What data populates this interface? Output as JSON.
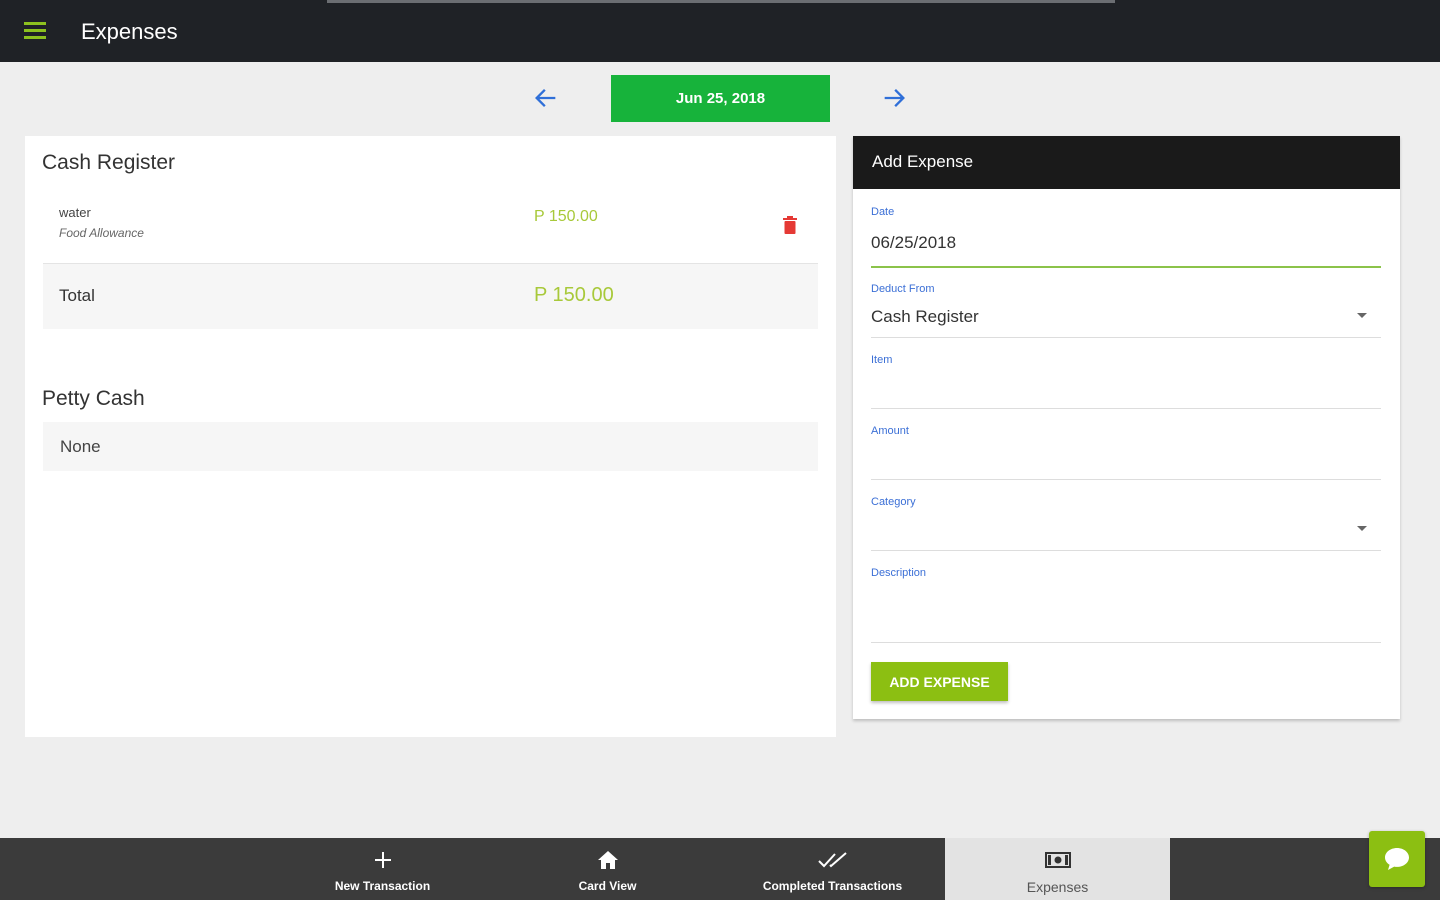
{
  "header": {
    "title": "Expenses"
  },
  "date_nav": {
    "date_label": "Jun 25, 2018"
  },
  "left": {
    "cash_register": {
      "title": "Cash Register",
      "items": [
        {
          "name": "water",
          "category": "Food Allowance",
          "amount": "P 150.00"
        }
      ],
      "total_label": "Total",
      "total_amount": "P 150.00"
    },
    "petty_cash": {
      "title": "Petty Cash",
      "empty_text": "None"
    }
  },
  "form": {
    "title": "Add Expense",
    "date": {
      "label": "Date",
      "value": "06/25/2018"
    },
    "deduct_from": {
      "label": "Deduct From",
      "value": "Cash Register"
    },
    "item": {
      "label": "Item",
      "value": ""
    },
    "amount": {
      "label": "Amount",
      "value": ""
    },
    "category": {
      "label": "Category",
      "value": ""
    },
    "description": {
      "label": "Description",
      "value": ""
    },
    "submit_label": "ADD EXPENSE"
  },
  "bottom_nav": [
    {
      "label": "New Transaction",
      "icon": "plus-icon"
    },
    {
      "label": "Card View",
      "icon": "home-icon"
    },
    {
      "label": "Completed Transactions",
      "icon": "double-check-icon"
    },
    {
      "label": "Expenses",
      "icon": "money-icon",
      "active": true
    }
  ],
  "colors": {
    "accent_green": "#8cbf12",
    "date_green": "#17b33b",
    "amount_green": "#a8c93a",
    "label_blue": "#3b6fd6",
    "delete_red": "#e53935"
  }
}
